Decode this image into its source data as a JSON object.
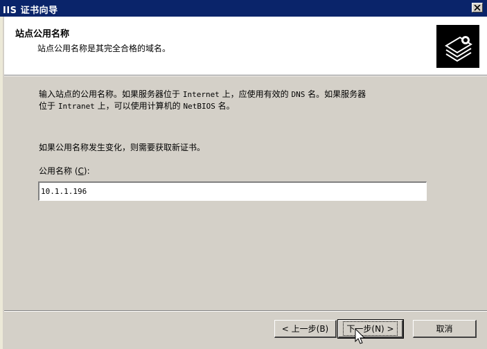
{
  "window": {
    "title": "IIS 证书向导",
    "close_label": "✕"
  },
  "header": {
    "title": "站点公用名称",
    "subtitle": "站点公用名称是其完全合格的域名。",
    "icon": "certificate-wizard-icon"
  },
  "body": {
    "intro_part1": "输入站点的公用名称。如果服务器位于 ",
    "intro_internet": "Internet",
    "intro_part2": " 上，应使用有效的 ",
    "intro_dns": "DNS",
    "intro_part3": " 名。如果服务器",
    "intro_line2_part1": "位于 ",
    "intro_intranet": "Intranet",
    "intro_line2_part2": " 上，可以使用计算机的 ",
    "intro_netbios": "NetBIOS",
    "intro_line2_part3": " 名。",
    "change_note": "如果公用名称发生变化，则需要获取新证书。",
    "field_label_prefix": "公用名称 (",
    "field_label_key": "C",
    "field_label_suffix": "):",
    "common_name_value": "10.1.1.196"
  },
  "buttons": {
    "back": "< 上一步(B)",
    "next": "下一步(N) >",
    "cancel": "取消"
  }
}
